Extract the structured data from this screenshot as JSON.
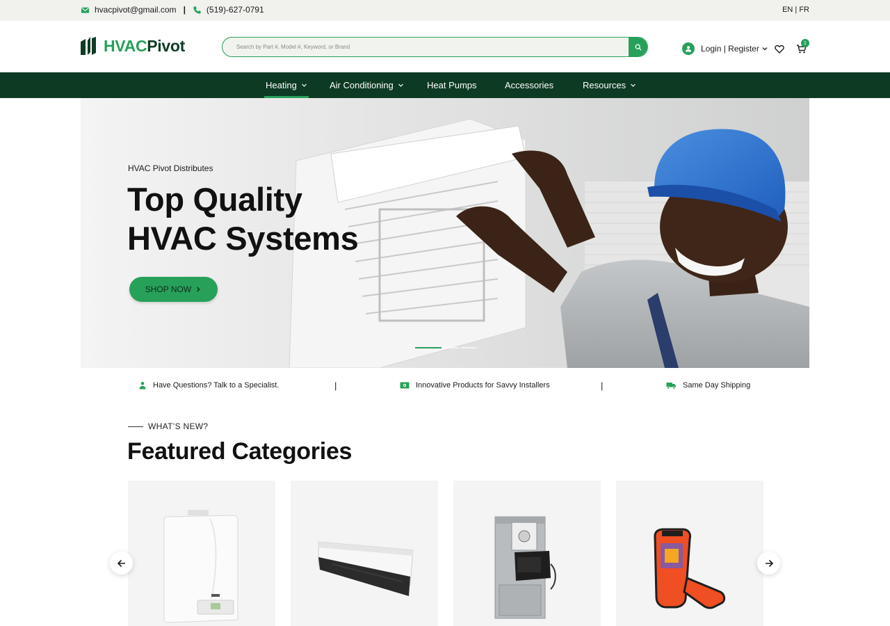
{
  "topbar": {
    "email": "hvacpivot@gmail.com",
    "separator": "|",
    "phone": "(519)-627-0791",
    "language": "EN | FR"
  },
  "brand": {
    "name_part1": "HVAC",
    "name_part2": "Pivot",
    "accent_color": "#27a05a",
    "dark_color": "#0d3a23"
  },
  "search": {
    "placeholder": "Search by Part #, Model #, Keyword, or Brand",
    "button_icon": "search-icon"
  },
  "account": {
    "label": "Login | Register",
    "cart_count": "1"
  },
  "nav": {
    "items": [
      {
        "label": "Heating",
        "has_dropdown": true,
        "active": true
      },
      {
        "label": "Air Conditioning",
        "has_dropdown": true,
        "active": false
      },
      {
        "label": "Heat Pumps",
        "has_dropdown": false,
        "active": false
      },
      {
        "label": "Accessories",
        "has_dropdown": false,
        "active": false
      },
      {
        "label": "Resources",
        "has_dropdown": true,
        "active": false
      }
    ]
  },
  "hero": {
    "eyebrow": "HVAC Pivot Distributes",
    "headline_line1": "Top Quality",
    "headline_line2": "HVAC Systems",
    "cta": "SHOP NOW",
    "slides_total": 3,
    "slide_active": 1
  },
  "features": [
    {
      "icon": "person-icon",
      "text": "Have Questions? Talk to a Specialist."
    },
    {
      "icon": "cash-icon",
      "text": "Innovative Products for Savvy Installers"
    },
    {
      "icon": "truck-icon",
      "text": "Same Day Shipping"
    }
  ],
  "feature_separator": "|",
  "featured": {
    "eyebrow": "WHAT’S NEW?",
    "title": "Featured Categories",
    "cards": [
      {
        "image": "wall-boiler-image"
      },
      {
        "image": "baseboard-heater-image"
      },
      {
        "image": "furnace-unit-image"
      },
      {
        "image": "thermal-imaging-tool-image"
      }
    ]
  }
}
